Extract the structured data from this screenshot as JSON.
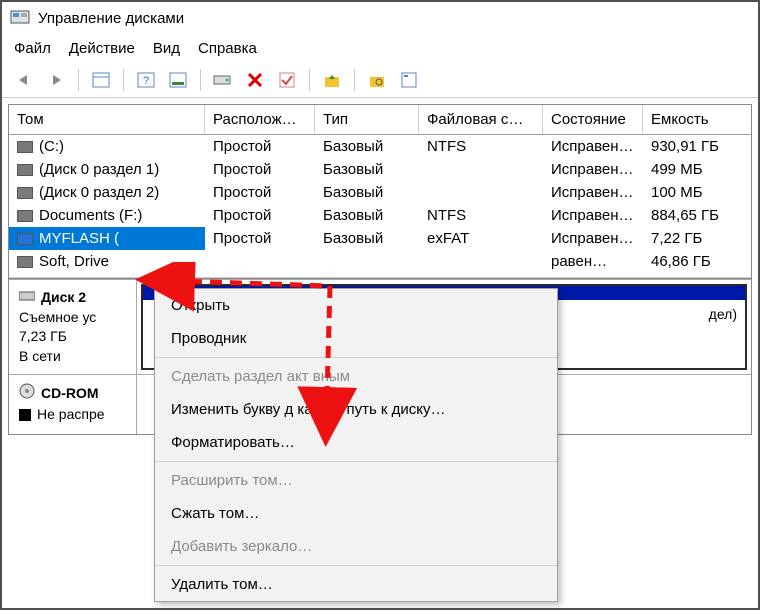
{
  "window": {
    "title": "Управление дисками"
  },
  "menu": {
    "file": "Файл",
    "action": "Действие",
    "view": "Вид",
    "help": "Справка"
  },
  "columns": {
    "volume": "Том",
    "layout": "Располож…",
    "type": "Тип",
    "fs": "Файловая с…",
    "state": "Состояние",
    "capacity": "Емкость"
  },
  "volumes": [
    {
      "name": "(C:)",
      "layout": "Простой",
      "type": "Базовый",
      "fs": "NTFS",
      "state": "Исправен…",
      "cap": "930,91 ГБ",
      "sel": false
    },
    {
      "name": "(Диск 0 раздел 1)",
      "layout": "Простой",
      "type": "Базовый",
      "fs": "",
      "state": "Исправен…",
      "cap": "499 МБ",
      "sel": false
    },
    {
      "name": "(Диск 0 раздел 2)",
      "layout": "Простой",
      "type": "Базовый",
      "fs": "",
      "state": "Исправен…",
      "cap": "100 МБ",
      "sel": false
    },
    {
      "name": "Documents (F:)",
      "layout": "Простой",
      "type": "Базовый",
      "fs": "NTFS",
      "state": "Исправен…",
      "cap": "884,65 ГБ",
      "sel": false
    },
    {
      "name": "MYFLASH (",
      "layout": "Простой",
      "type": "Базовый",
      "fs": "exFAT",
      "state": "Исправен…",
      "cap": "7,22 ГБ",
      "sel": true
    },
    {
      "name": "Soft, Drive",
      "layout": "",
      "type": "",
      "fs": "",
      "state": "равен…",
      "cap": "46,86 ГБ",
      "sel": false
    }
  ],
  "disk2": {
    "title": "Диск 2",
    "type": "Съемное ус",
    "size": "7,23 ГБ",
    "status": "В сети",
    "part_hint": "дел)"
  },
  "cdrom": {
    "title": "CD-ROM",
    "status": "Не распре"
  },
  "ctx": {
    "open": "Открыть",
    "explorer": "Проводник",
    "make_active": "Сделать раздел акт    вным",
    "change_letter": "Изменить букву д    ка или путь к диску…",
    "format": "Форматировать…",
    "extend": "Расширить том…",
    "shrink": "Сжать том…",
    "mirror": "Добавить зеркало…",
    "delete": "Удалить том…"
  }
}
